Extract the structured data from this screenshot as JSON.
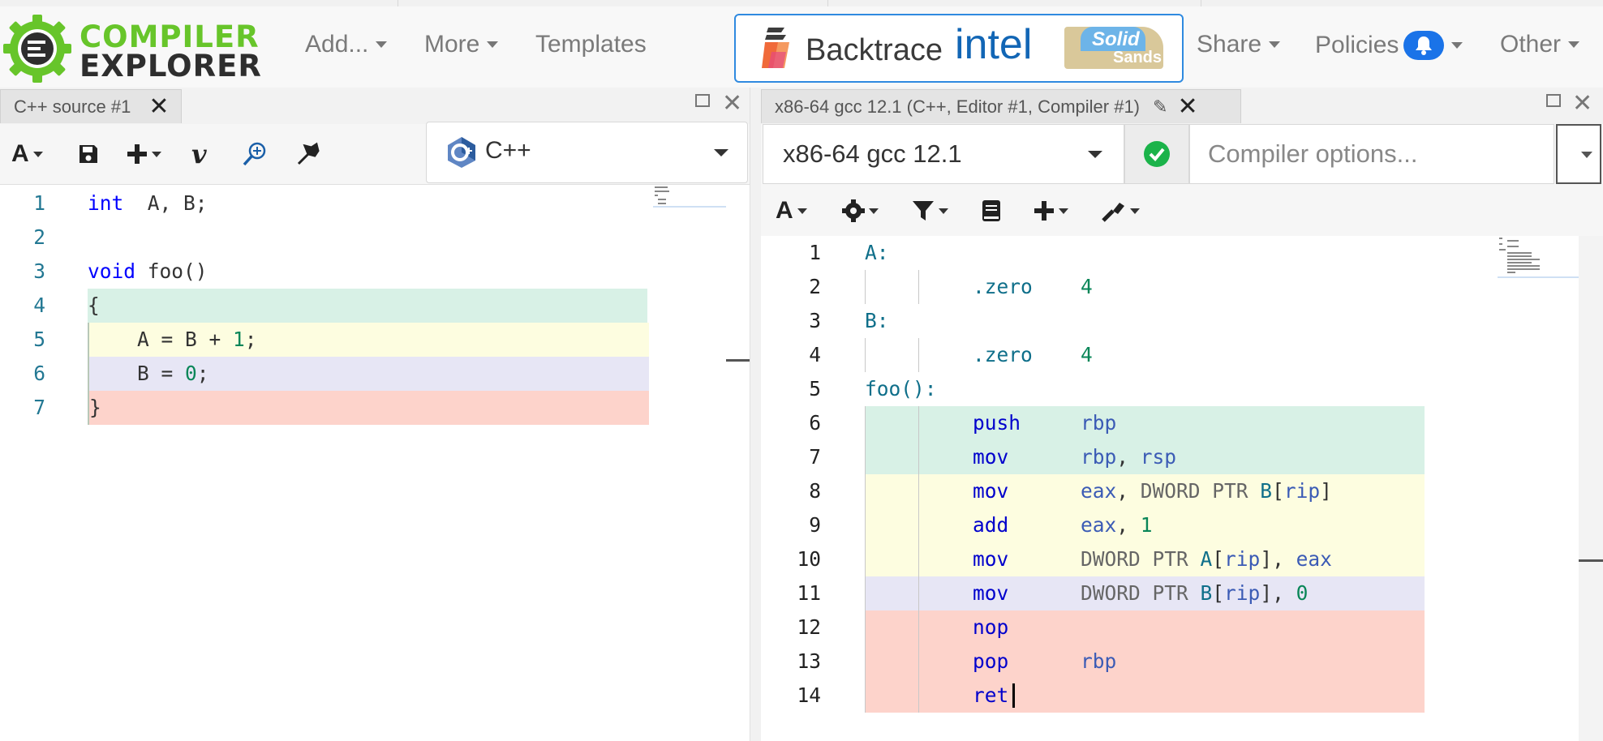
{
  "navbar": {
    "logo": {
      "line1": "COMPILER",
      "line2": "EXPLORER"
    },
    "menu": [
      {
        "label": "Add...",
        "has_caret": true
      },
      {
        "label": "More",
        "has_caret": true
      },
      {
        "label": "Templates",
        "has_caret": false
      }
    ],
    "sponsors": {
      "backtrace": "Backtrace",
      "intel": "intel",
      "solid": "Solid",
      "sands": "Sands"
    },
    "right_menu": [
      {
        "label": "Share",
        "has_caret": true
      },
      {
        "label": "Policies",
        "has_caret": true,
        "icon": "bell-icon"
      },
      {
        "label": "Other",
        "has_caret": true
      }
    ]
  },
  "source_pane": {
    "tab_title": "C++ source #1",
    "close_glyph": "✕",
    "language": "C++",
    "toolbar_icons": [
      "font-size-icon",
      "save-icon",
      "add-icon",
      "vim-icon",
      "search-icon",
      "runtime-tools-icon"
    ],
    "lines": [
      {
        "n": "1",
        "tokens": [
          [
            "kw",
            "int"
          ],
          [
            "",
            "  A, B;"
          ]
        ],
        "bg": ""
      },
      {
        "n": "2",
        "tokens": [],
        "bg": ""
      },
      {
        "n": "3",
        "tokens": [
          [
            "kw",
            "void"
          ],
          [
            "",
            " foo()"
          ]
        ],
        "bg": ""
      },
      {
        "n": "4",
        "tokens": [
          [
            "",
            "{"
          ]
        ],
        "bg": "green"
      },
      {
        "n": "5",
        "tokens": [
          [
            "",
            "    A = B + "
          ],
          [
            "num",
            "1"
          ],
          [
            "",
            ";"
          ]
        ],
        "bg": "yellow"
      },
      {
        "n": "6",
        "tokens": [
          [
            "",
            "    B = "
          ],
          [
            "num",
            "0"
          ],
          [
            "",
            ";"
          ]
        ],
        "bg": "lav"
      },
      {
        "n": "7",
        "tokens": [
          [
            "",
            "}"
          ]
        ],
        "bg": "red"
      }
    ]
  },
  "compiler_pane": {
    "tab_title": "x86-64 gcc 12.1 (C++, Editor #1, Compiler #1)",
    "compiler": "x86-64 gcc 12.1",
    "options_placeholder": "Compiler options...",
    "status": "ok",
    "toolbar_icons": [
      "font-size-icon",
      "settings-icon",
      "filter-icon",
      "libraries-icon",
      "add-icon",
      "tools-icon"
    ],
    "lines": [
      {
        "n": "1",
        "label": "A:",
        "bg": ""
      },
      {
        "n": "2",
        "op": ".zero",
        "args": [
          [
            "num",
            "4"
          ]
        ],
        "bg": "",
        "directive": true
      },
      {
        "n": "3",
        "label": "B:",
        "bg": ""
      },
      {
        "n": "4",
        "op": ".zero",
        "args": [
          [
            "num",
            "4"
          ]
        ],
        "bg": "",
        "directive": true
      },
      {
        "n": "5",
        "label": "foo():",
        "bg": ""
      },
      {
        "n": "6",
        "op": "push",
        "args": [
          [
            "reg",
            "rbp"
          ]
        ],
        "bg": "green"
      },
      {
        "n": "7",
        "op": "mov",
        "args": [
          [
            "reg",
            "rbp"
          ],
          [
            "",
            ", "
          ],
          [
            "reg",
            "rsp"
          ]
        ],
        "bg": "green"
      },
      {
        "n": "8",
        "op": "mov",
        "args": [
          [
            "reg",
            "eax"
          ],
          [
            "",
            ", "
          ],
          [
            "ptr",
            "DWORD PTR "
          ],
          [
            "dir",
            "B"
          ],
          [
            "",
            "["
          ],
          [
            "reg",
            "rip"
          ],
          [
            "",
            "]"
          ]
        ],
        "bg": "yellow"
      },
      {
        "n": "9",
        "op": "add",
        "args": [
          [
            "reg",
            "eax"
          ],
          [
            "",
            ", "
          ],
          [
            "num",
            "1"
          ]
        ],
        "bg": "yellow"
      },
      {
        "n": "10",
        "op": "mov",
        "args": [
          [
            "ptr",
            "DWORD PTR "
          ],
          [
            "dir",
            "A"
          ],
          [
            "",
            "["
          ],
          [
            "reg",
            "rip"
          ],
          [
            "",
            "], "
          ],
          [
            "reg",
            "eax"
          ]
        ],
        "bg": "yellow"
      },
      {
        "n": "11",
        "op": "mov",
        "args": [
          [
            "ptr",
            "DWORD PTR "
          ],
          [
            "dir",
            "B"
          ],
          [
            "",
            "["
          ],
          [
            "reg",
            "rip"
          ],
          [
            "",
            "], "
          ],
          [
            "num",
            "0"
          ]
        ],
        "bg": "lav"
      },
      {
        "n": "12",
        "op": "nop",
        "args": [],
        "bg": "red"
      },
      {
        "n": "13",
        "op": "pop",
        "args": [
          [
            "reg",
            "rbp"
          ]
        ],
        "bg": "red"
      },
      {
        "n": "14",
        "op": "ret",
        "args": [],
        "bg": "red",
        "cursor": true
      }
    ]
  },
  "colors": {
    "accent": "#67c52a",
    "link_blue": "#2f8ae0",
    "ok_green": "#1bb34a"
  }
}
